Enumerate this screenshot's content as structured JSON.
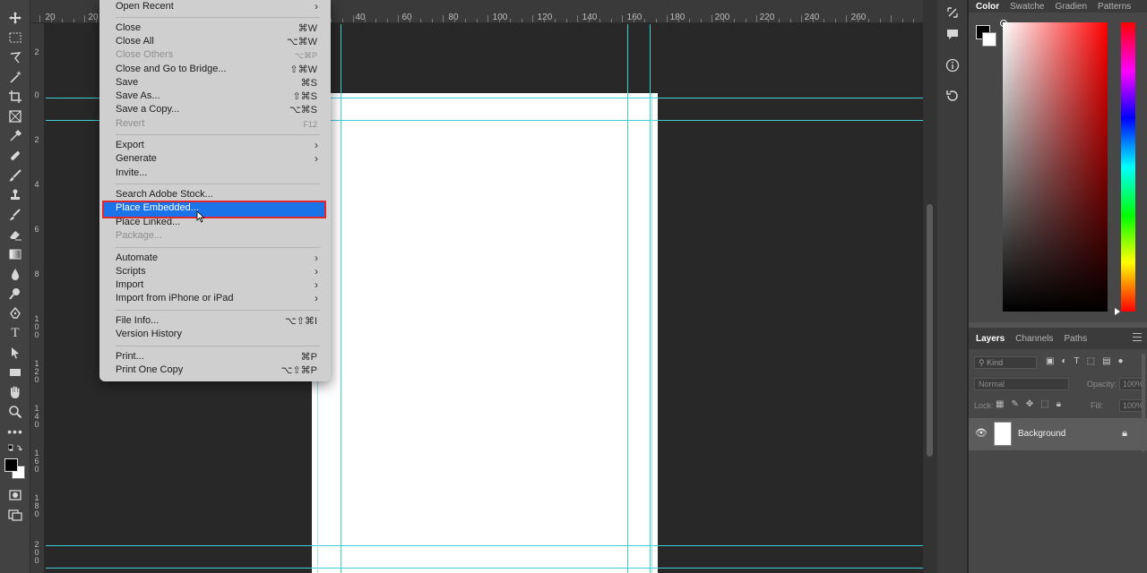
{
  "menu": {
    "items": [
      {
        "label": "Open Recent",
        "shortcut": "",
        "submenu": true,
        "disabled": false
      },
      {
        "label": "Close",
        "shortcut": "⌘W",
        "submenu": false,
        "disabled": false
      },
      {
        "label": "Close All",
        "shortcut": "⌥⌘W",
        "submenu": false,
        "disabled": false
      },
      {
        "label": "Close Others",
        "shortcut": "⌥⌘P",
        "submenu": false,
        "disabled": true
      },
      {
        "label": "Close and Go to Bridge...",
        "shortcut": "⇧⌘W",
        "submenu": false,
        "disabled": false
      },
      {
        "label": "Save",
        "shortcut": "⌘S",
        "submenu": false,
        "disabled": false
      },
      {
        "label": "Save As...",
        "shortcut": "⇧⌘S",
        "submenu": false,
        "disabled": false
      },
      {
        "label": "Save a Copy...",
        "shortcut": "⌥⌘S",
        "submenu": false,
        "disabled": false
      },
      {
        "label": "Revert",
        "shortcut": "F12",
        "submenu": false,
        "disabled": true
      },
      {
        "label": "Export",
        "shortcut": "",
        "submenu": true,
        "disabled": false
      },
      {
        "label": "Generate",
        "shortcut": "",
        "submenu": true,
        "disabled": false
      },
      {
        "label": "Invite...",
        "shortcut": "",
        "submenu": false,
        "disabled": false
      },
      {
        "label": "Search Adobe Stock...",
        "shortcut": "",
        "submenu": false,
        "disabled": false
      },
      {
        "label": "Place Embedded...",
        "shortcut": "",
        "submenu": false,
        "disabled": false,
        "highlighted": true
      },
      {
        "label": "Place Linked...",
        "shortcut": "",
        "submenu": false,
        "disabled": false
      },
      {
        "label": "Package...",
        "shortcut": "",
        "submenu": false,
        "disabled": true
      },
      {
        "label": "Automate",
        "shortcut": "",
        "submenu": true,
        "disabled": false
      },
      {
        "label": "Scripts",
        "shortcut": "",
        "submenu": true,
        "disabled": false
      },
      {
        "label": "Import",
        "shortcut": "",
        "submenu": true,
        "disabled": false
      },
      {
        "label": "Import from iPhone or iPad",
        "shortcut": "",
        "submenu": true,
        "disabled": false
      },
      {
        "label": "File Info...",
        "shortcut": "⌥⇧⌘I",
        "submenu": false,
        "disabled": false
      },
      {
        "label": "Version History",
        "shortcut": "",
        "submenu": false,
        "disabled": false
      },
      {
        "label": "Print...",
        "shortcut": "⌘P",
        "submenu": false,
        "disabled": false
      },
      {
        "label": "Print One Copy",
        "shortcut": "⌥⇧⌘P",
        "submenu": false,
        "disabled": false
      }
    ],
    "submenu_glyph": "›"
  },
  "ruler_top": {
    "ticks": [
      "20",
      "20",
      "40",
      "60",
      "80",
      "100",
      "120",
      "140",
      "160",
      "180",
      "200",
      "220",
      "240",
      "260"
    ]
  },
  "ruler_left": {
    "ticks": [
      "2",
      "0",
      "2",
      "4",
      "6",
      "8",
      "100",
      "120",
      "140",
      "160",
      "180",
      "200"
    ]
  },
  "color_panel": {
    "tabs": [
      "Color",
      "Swatche",
      "Gradien",
      "Patterns"
    ],
    "foreground": "#000000",
    "background": "#ffffff",
    "hue_color": "#ff0000"
  },
  "layers_panel": {
    "tabs": [
      "Layers",
      "Channels",
      "Paths"
    ],
    "filter_placeholder": "Kind",
    "blend_mode": "Normal",
    "opacity_label": "Opacity:",
    "opacity_value": "100%",
    "lock_label": "Lock:",
    "fill_label": "Fill:",
    "fill_value": "100%",
    "layers": [
      {
        "name": "Background",
        "visible": true,
        "locked": true
      }
    ]
  },
  "colors": {
    "guide": "#3fd0d6",
    "highlight": "#1a73e8",
    "annotation": "#e0262f"
  }
}
